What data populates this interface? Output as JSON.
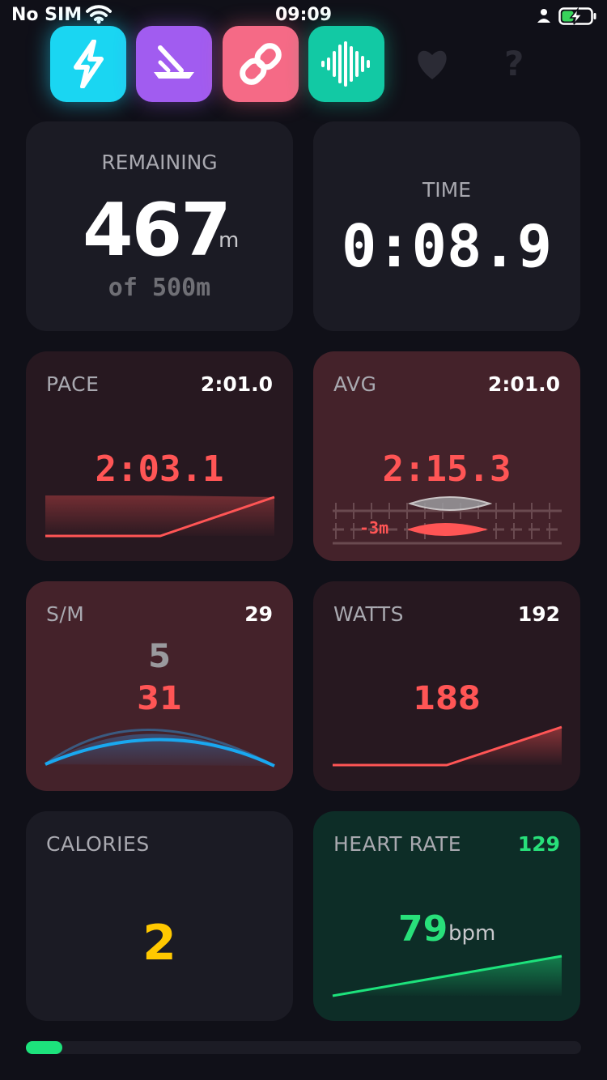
{
  "status": {
    "carrier": "No SIM",
    "time": "09:09"
  },
  "toolbar": {
    "icons": [
      "lightning-icon",
      "rower-icon",
      "link-icon",
      "waveform-icon",
      "heart-icon",
      "help-icon"
    ],
    "help_glyph": "?"
  },
  "remaining": {
    "label": "REMAINING",
    "value": "467",
    "unit": "m",
    "of_text": "of 500m"
  },
  "time": {
    "label": "TIME",
    "value": "0:08.9"
  },
  "pace": {
    "label": "PACE",
    "corner": "2:01.0",
    "value": "2:03.1"
  },
  "avg": {
    "label": "AVG",
    "corner": "2:01.0",
    "value": "2:15.3",
    "margin": "-3m"
  },
  "strokes": {
    "label": "S/M",
    "corner": "29",
    "previous": "5",
    "value": "31"
  },
  "watts": {
    "label": "WATTS",
    "corner": "192",
    "value": "188"
  },
  "calories": {
    "label": "CALORIES",
    "value": "2"
  },
  "heart_rate": {
    "label": "HEART RATE",
    "corner": "129",
    "value": "79",
    "unit": "bpm"
  },
  "progress": {
    "fraction": 0.066
  },
  "colors": {
    "accent_red": "#ff5555",
    "accent_green": "#28e07a",
    "accent_yellow": "#ffc800",
    "accent_blue": "#19a8f0",
    "card_dark": "#1b1b24",
    "card_red": "#44222a",
    "card_green": "#0d2d27"
  }
}
